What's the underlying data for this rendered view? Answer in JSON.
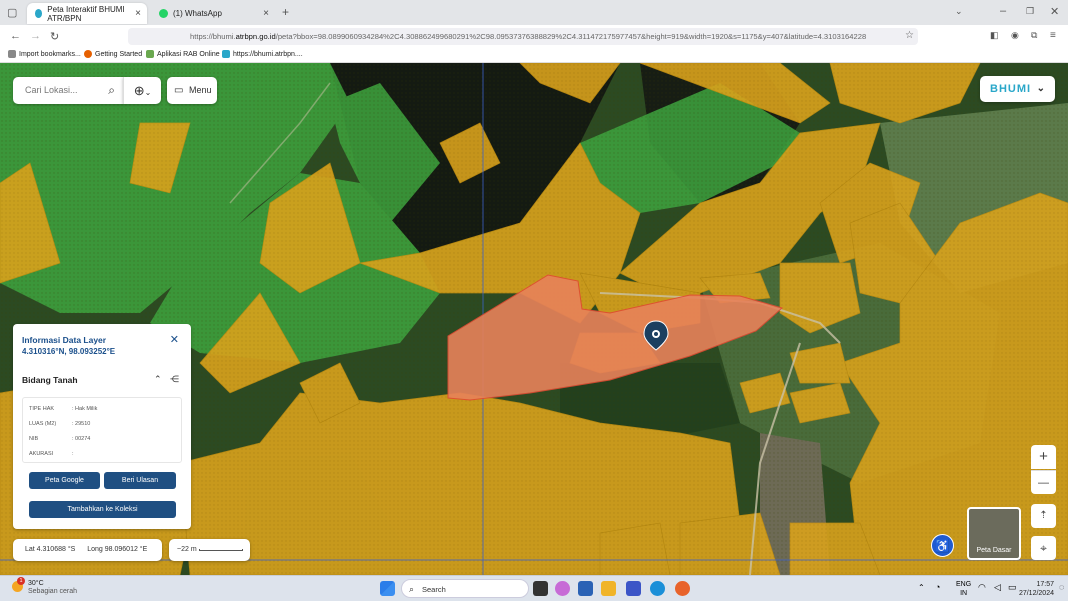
{
  "browser": {
    "tabs": [
      {
        "label": "Peta Interaktif BHUMI ATR/BPN"
      },
      {
        "label": "(1) WhatsApp"
      }
    ],
    "new_tab": "+",
    "url_prefix": "https://bhumi.",
    "url_domain": "atrbpn.go.id",
    "url_rest": "/peta?bbox=98.0899060934284%2C4.308862499680291%2C98.09537376388829%2C4.311472175977457&height=919&width=1920&s=1175&y=407&latitude=4.3103164228",
    "bookmarks": [
      "Import bookmarks...",
      "Getting Started",
      "Aplikasi RAB Online",
      "https://bhumi.atrbpn...."
    ]
  },
  "map_ui": {
    "search_placeholder": "Cari Lokasi...",
    "menu_label": "Menu",
    "brand": "BHUMI",
    "zoom_in": "+",
    "zoom_out": "—",
    "basemap_label": "Peta Dasar",
    "latlong": {
      "lat": "Lat 4.310688 °S",
      "long": "Long 98.096012 °E"
    },
    "scale_label": "~22 m"
  },
  "info_panel": {
    "title": "Informasi Data Layer",
    "coordinates": "4.310316°N, 98.093252°E",
    "section": "Bidang Tanah",
    "rows": [
      {
        "label": "TIPE HAK",
        "value": ": Hak Milik"
      },
      {
        "label": "LUAS (M2)",
        "value": ": 29510"
      },
      {
        "label": "NIB",
        "value": ": 00274"
      },
      {
        "label": "AKURASI",
        "value": ":"
      }
    ],
    "buttons": {
      "google": "Peta Google",
      "review": "Beri Ulasan",
      "collection": "Tambahkan ke Koleksi"
    }
  },
  "taskbar": {
    "weather_temp": "30°C",
    "weather_desc": "Sebagian cerah",
    "weather_badge": "1",
    "search_label": "Search",
    "lang": "ENG",
    "region": "IN",
    "time": "17:57",
    "date": "27/12/2024"
  },
  "colors": {
    "parcel_orange": "#d9a21c",
    "forest_green": "#3ea13d",
    "selected": "#e8825a",
    "accent": "#1f4f82"
  }
}
